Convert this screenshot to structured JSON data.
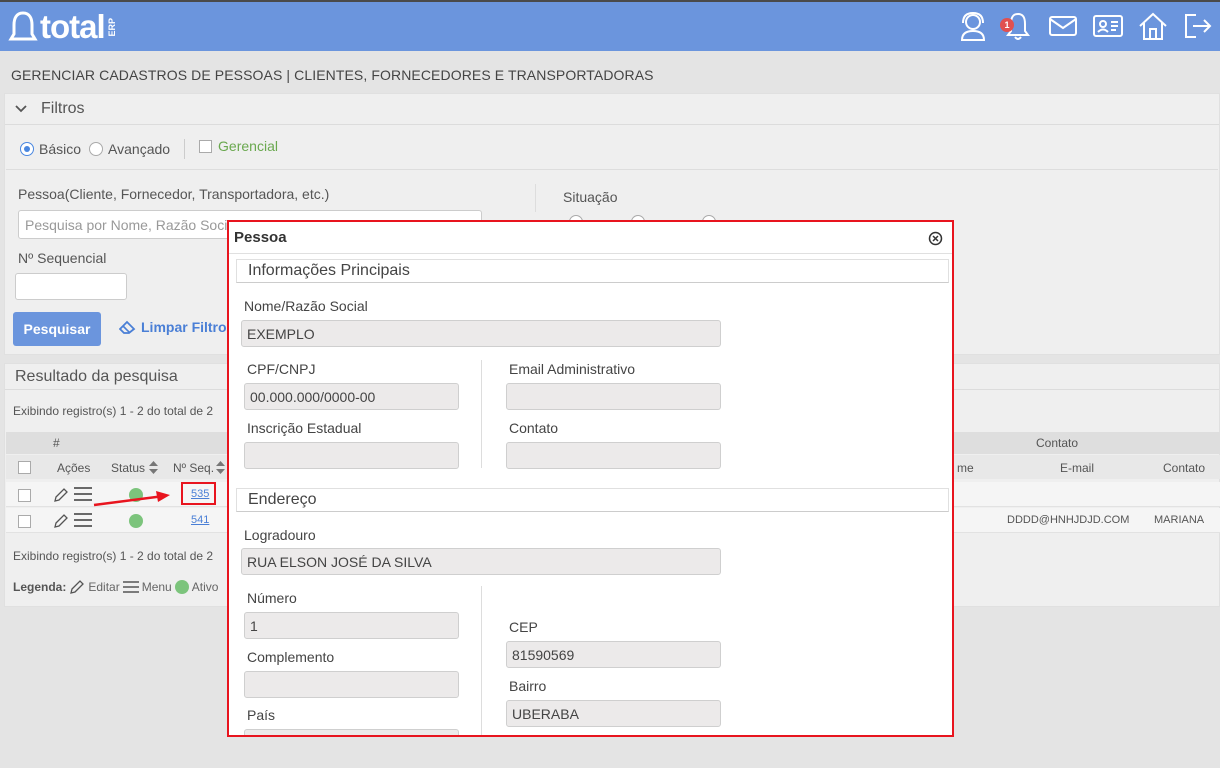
{
  "header": {
    "logo_text": "total",
    "logo_sub": "ERP",
    "notification_count": "1",
    "icons": [
      "support-agent-icon",
      "bell-icon",
      "mail-icon",
      "id-card-icon",
      "home-icon",
      "logout-icon"
    ]
  },
  "page": {
    "title": "GERENCIAR CADASTROS DE PESSOAS | CLIENTES, FORNECEDORES E TRANSPORTADORAS"
  },
  "filters": {
    "title": "Filtros",
    "mode_basic": "Básico",
    "mode_advanced": "Avançado",
    "managerial": "Gerencial",
    "person_label": "Pessoa(Cliente, Fornecedor, Transportadora, etc.)",
    "person_placeholder": "Pesquisa por Nome, Razão Social",
    "sequence_label": "Nº Sequencial",
    "situation_label": "Situação",
    "search_button": "Pesquisar",
    "clear_button": "Limpar Filtros"
  },
  "results": {
    "title": "Resultado da pesquisa",
    "summary": "Exibindo registro(s) 1 - 2 do total de 2",
    "group_hash": "#",
    "group_contact": "Contato",
    "columns": {
      "actions": "Ações",
      "status": "Status",
      "seq": "Nº Seq.",
      "name_partial": "me",
      "email": "E-mail",
      "contact": "Contato"
    },
    "rows": [
      {
        "seq": "535",
        "email": "",
        "contact": ""
      },
      {
        "seq": "541",
        "email": "DDDD@HNHJDJD.COM",
        "contact": "MARIANA"
      }
    ],
    "legend": {
      "label": "Legenda:",
      "edit": "Editar",
      "menu": "Menu",
      "active": "Ativo"
    }
  },
  "modal": {
    "title": "Pessoa",
    "section_main": "Informações Principais",
    "name_label": "Nome/Razão Social",
    "name_value": "EXEMPLO",
    "cpf_label": "CPF/CNPJ",
    "cpf_value": "00.000.000/0000-00",
    "email_label": "Email Administrativo",
    "email_value": "",
    "ie_label": "Inscrição Estadual",
    "ie_value": "",
    "contact_label": "Contato",
    "contact_value": "",
    "section_address": "Endereço",
    "street_label": "Logradouro",
    "street_value": "RUA ELSON JOSÉ DA SILVA",
    "number_label": "Número",
    "number_value": "1",
    "cep_label": "CEP",
    "cep_value": "81590569",
    "complement_label": "Complemento",
    "complement_value": "",
    "district_label": "Bairro",
    "district_value": "UBERABA",
    "country_label": "País",
    "country_value": ""
  },
  "colors": {
    "header_bg": "#6b95dd",
    "highlight": "#e8141e",
    "status_active": "#7cc47c"
  }
}
